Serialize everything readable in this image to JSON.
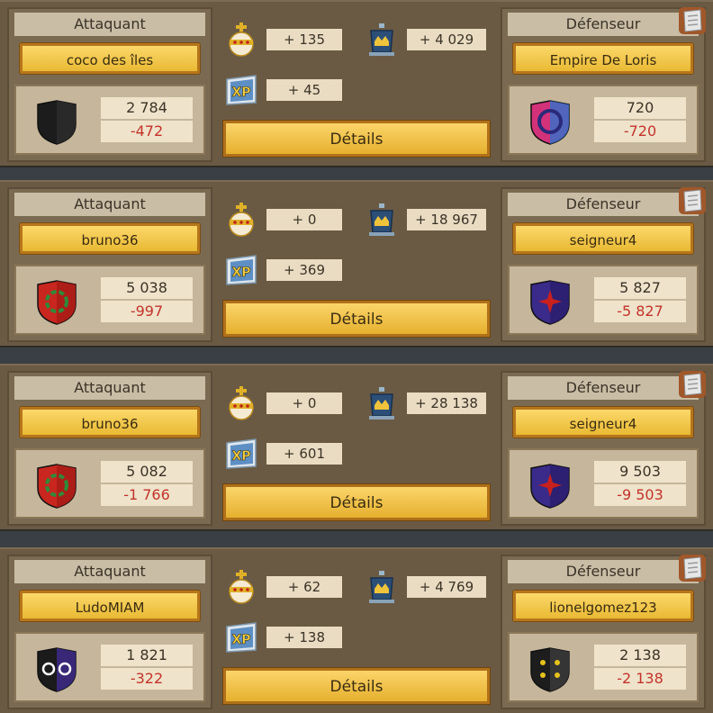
{
  "labels": {
    "attacker": "Attaquant",
    "defender": "Défenseur",
    "details": "Détails"
  },
  "icons": {
    "orb": "orb-icon",
    "trophy": "trophy-icon",
    "xp": "xp-icon",
    "report": "scroll-icon"
  },
  "colors": {
    "gold_button": "#f2c94c",
    "loss_red": "#c3332b",
    "panel_bg": "#7a6a52"
  },
  "reports": [
    {
      "attacker": {
        "name": "coco des îles",
        "total": "2 784",
        "loss": "-472",
        "shield": "black"
      },
      "defender": {
        "name": "Empire De Loris",
        "total": "720",
        "loss": "-720",
        "shield": "pink-blue"
      },
      "orb": "+ 135",
      "trophy": "+ 4 029",
      "xp": "+ 45"
    },
    {
      "attacker": {
        "name": "bruno36",
        "total": "5 038",
        "loss": "-997",
        "shield": "red-green"
      },
      "defender": {
        "name": "seigneur4",
        "total": "5 827",
        "loss": "-5 827",
        "shield": "purple-red"
      },
      "orb": "+ 0",
      "trophy": "+ 18 967",
      "xp": "+ 369"
    },
    {
      "attacker": {
        "name": "bruno36",
        "total": "5 082",
        "loss": "-1 766",
        "shield": "red-green"
      },
      "defender": {
        "name": "seigneur4",
        "total": "9 503",
        "loss": "-9 503",
        "shield": "purple-red"
      },
      "orb": "+ 0",
      "trophy": "+ 28 138",
      "xp": "+ 601"
    },
    {
      "attacker": {
        "name": "LudoMIAM",
        "total": "1 821",
        "loss": "-322",
        "shield": "black-purple"
      },
      "defender": {
        "name": "lionelgomez123",
        "total": "2 138",
        "loss": "-2 138",
        "shield": "black-yellow"
      },
      "orb": "+ 62",
      "trophy": "+ 4 769",
      "xp": "+ 138"
    }
  ]
}
